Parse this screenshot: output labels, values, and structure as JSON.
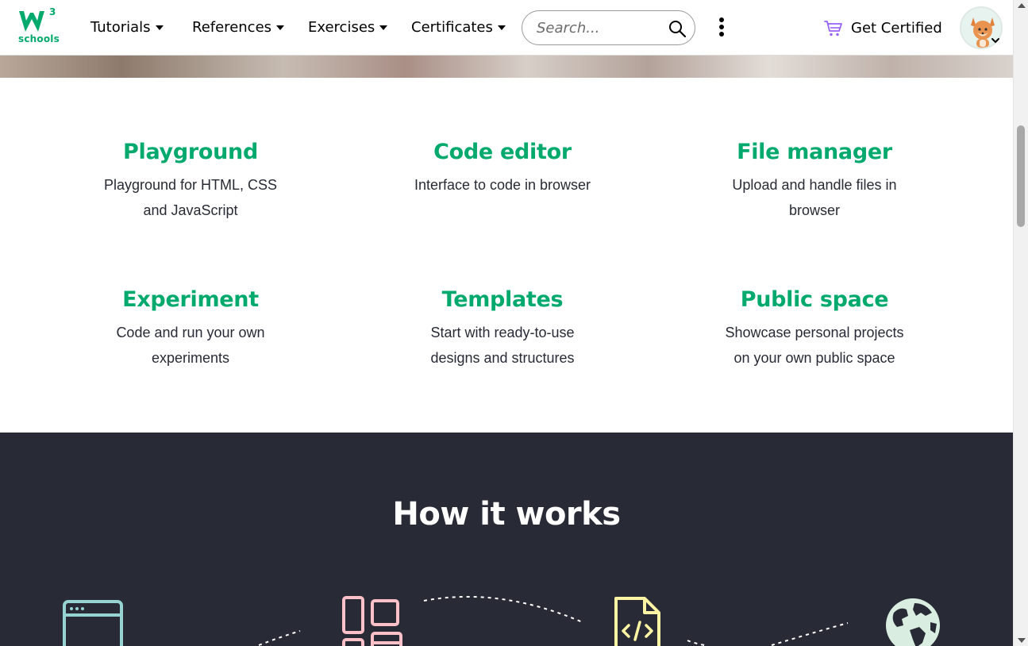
{
  "brand": {
    "logo_letters": "W",
    "logo_superscript": "3",
    "logo_text": "schools",
    "color": "#04aa6d"
  },
  "nav": {
    "items": [
      {
        "label": "Tutorials"
      },
      {
        "label": "References"
      },
      {
        "label": "Exercises"
      },
      {
        "label": "Certificates"
      }
    ],
    "search_placeholder": "Search...",
    "get_certified_label": "Get Certified",
    "icons": [
      "search-icon",
      "more-options-icon",
      "cart-icon",
      "avatar",
      "chevron-down-icon"
    ]
  },
  "features": [
    {
      "title": "Playground",
      "line1": "Playground for HTML, CSS",
      "line2": "and JavaScript"
    },
    {
      "title": "Code editor",
      "line1": "Interface to code in browser",
      "line2": ""
    },
    {
      "title": "File manager",
      "line1": "Upload and handle files in",
      "line2": "browser"
    },
    {
      "title": "Experiment",
      "line1": "Code and run your own",
      "line2": "experiments"
    },
    {
      "title": "Templates",
      "line1": "Start with ready-to-use",
      "line2": "designs and structures"
    },
    {
      "title": "Public space",
      "line1": "Showcase personal projects",
      "line2": "on your own public space"
    }
  ],
  "how_it_works": {
    "title": "How it works",
    "step_icons": [
      {
        "icon": "browser-window-icon",
        "color": "#96d4d4"
      },
      {
        "icon": "layout-grid-icon",
        "color": "#ffc0c7"
      },
      {
        "icon": "code-file-icon",
        "color": "#fff4a3"
      },
      {
        "icon": "globe-icon",
        "color": "#d9eee1"
      }
    ]
  },
  "colors": {
    "accent": "#04aa6d",
    "dark_section": "#282a35",
    "text": "#282a35"
  }
}
